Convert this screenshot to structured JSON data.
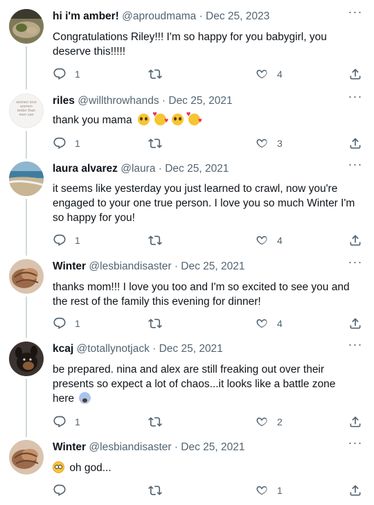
{
  "tweets": [
    {
      "display_name": "hi i'm amber!",
      "meta": "@aproudmama · Dec 25, 2023",
      "text": "Congratulations Riley!!! I'm so happy for you babygirl, you deserve this!!!!!",
      "replies": "1",
      "retweets": "",
      "likes": "4",
      "avatar": "food-photo-avatar"
    },
    {
      "display_name": "riles",
      "meta": "@willthrowhands · Dec 25, 2021",
      "text": "thank you mama",
      "emojis": [
        "pleading-face",
        "smiling-face-with-hearts",
        "pleading-face",
        "smiling-face-with-hearts"
      ],
      "replies": "1",
      "retweets": "",
      "likes": "3",
      "avatar_text": [
        "women love",
        "women",
        "better than",
        "men can"
      ]
    },
    {
      "display_name": "laura alvarez",
      "meta": "@laura · Dec 25, 2021",
      "text": "it seems like yesterday you just learned to crawl, now you're engaged to your one true person. I love you so much Winter I'm so happy for you!",
      "replies": "1",
      "retweets": "",
      "likes": "4",
      "avatar": "beach-photo-avatar"
    },
    {
      "display_name": "Winter",
      "meta": "@lesbiandisaster · Dec 25, 2021",
      "text": "thanks mom!!! I love you too and I'm so excited to see you and the rest of the family this evening for dinner!",
      "replies": "1",
      "retweets": "",
      "likes": "4",
      "avatar": "holding-hands-avatar"
    },
    {
      "display_name": "kcaj",
      "meta": "@totallynotjack · Dec 25, 2021",
      "text": "be prepared. nina and alex are still freaking out over their presents so expect a lot of chaos...it looks like a battle zone here",
      "emojis": [
        "face-screaming-in-fear"
      ],
      "replies": "1",
      "retweets": "",
      "likes": "2",
      "avatar": "dog-photo-avatar"
    },
    {
      "display_name": "Winter",
      "meta": "@lesbiandisaster · Dec 25, 2021",
      "text": "oh god...",
      "emojis": [
        "flushed-face"
      ],
      "replies": "",
      "retweets": "",
      "likes": "1",
      "avatar": "holding-hands-avatar"
    }
  ],
  "colors": {
    "text": "#0f1419",
    "muted": "#536471",
    "thread_line": "#cfd9de",
    "background": "#ffffff"
  },
  "icons": [
    "more-icon",
    "reply-icon",
    "retweet-icon",
    "like-icon",
    "share-icon"
  ]
}
